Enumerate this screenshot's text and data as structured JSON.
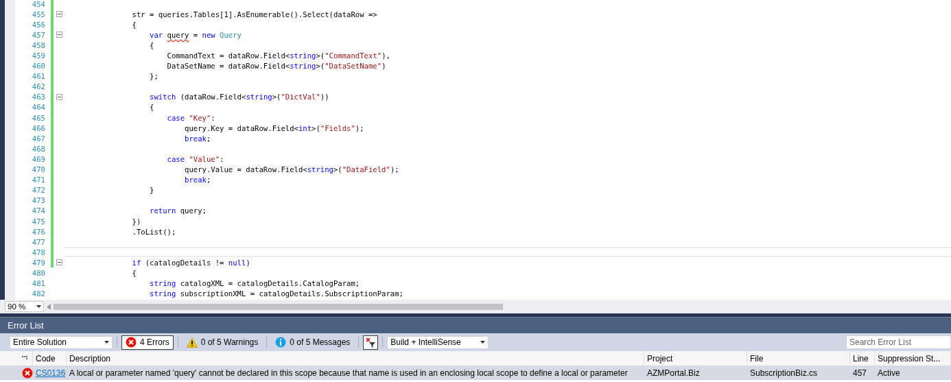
{
  "editor": {
    "lines": [
      {
        "number": "454",
        "changed": true,
        "fold": false,
        "current": false
      },
      {
        "number": "455",
        "changed": true,
        "fold": true,
        "current": false,
        "tokens": [
          {
            "kind": "plain",
            "text": "            str = queries.Tables[1].AsEnumerable().Select(dataRow =>"
          }
        ]
      },
      {
        "number": "456",
        "changed": true,
        "fold": false,
        "current": false,
        "tokens": [
          {
            "kind": "plain",
            "text": "            {"
          }
        ]
      },
      {
        "number": "457",
        "changed": true,
        "fold": true,
        "current": false,
        "tokens": [
          {
            "kind": "keyword",
            "text": "                var "
          },
          {
            "kind": "error",
            "text": "query"
          },
          {
            "kind": "plain",
            "text": " = "
          },
          {
            "kind": "keyword",
            "text": "new "
          },
          {
            "kind": "type",
            "text": "Query"
          }
        ]
      },
      {
        "number": "458",
        "changed": true,
        "fold": false,
        "current": false,
        "tokens": [
          {
            "kind": "plain",
            "text": "                {"
          }
        ]
      },
      {
        "number": "459",
        "changed": true,
        "fold": false,
        "current": false,
        "tokens": [
          {
            "kind": "plain",
            "text": "                    CommandText = dataRow.Field<"
          },
          {
            "kind": "keyword",
            "text": "string"
          },
          {
            "kind": "plain",
            "text": ">("
          },
          {
            "kind": "string",
            "text": "\"CommandText\""
          },
          {
            "kind": "plain",
            "text": "),"
          }
        ]
      },
      {
        "number": "460",
        "changed": true,
        "fold": false,
        "current": false,
        "tokens": [
          {
            "kind": "plain",
            "text": "                    DataSetName = dataRow.Field<"
          },
          {
            "kind": "keyword",
            "text": "string"
          },
          {
            "kind": "plain",
            "text": ">("
          },
          {
            "kind": "string",
            "text": "\"DataSetName\""
          },
          {
            "kind": "plain",
            "text": ")"
          }
        ]
      },
      {
        "number": "461",
        "changed": true,
        "fold": false,
        "current": false,
        "tokens": [
          {
            "kind": "plain",
            "text": "                };"
          }
        ]
      },
      {
        "number": "462",
        "changed": true,
        "fold": false,
        "current": false
      },
      {
        "number": "463",
        "changed": true,
        "fold": true,
        "current": false,
        "tokens": [
          {
            "kind": "keyword",
            "text": "                switch"
          },
          {
            "kind": "plain",
            "text": " (dataRow.Field<"
          },
          {
            "kind": "keyword",
            "text": "string"
          },
          {
            "kind": "plain",
            "text": ">("
          },
          {
            "kind": "string",
            "text": "\"DictVal\""
          },
          {
            "kind": "plain",
            "text": "))"
          }
        ]
      },
      {
        "number": "464",
        "changed": true,
        "fold": false,
        "current": false,
        "tokens": [
          {
            "kind": "plain",
            "text": "                {"
          }
        ]
      },
      {
        "number": "465",
        "changed": true,
        "fold": false,
        "current": false,
        "tokens": [
          {
            "kind": "keyword",
            "text": "                    case "
          },
          {
            "kind": "string",
            "text": "\"Key\""
          },
          {
            "kind": "plain",
            "text": ":"
          }
        ]
      },
      {
        "number": "466",
        "changed": true,
        "fold": false,
        "current": false,
        "tokens": [
          {
            "kind": "plain",
            "text": "                        query.Key = dataRow.Field<"
          },
          {
            "kind": "keyword",
            "text": "int"
          },
          {
            "kind": "plain",
            "text": ">("
          },
          {
            "kind": "string",
            "text": "\"Fields\""
          },
          {
            "kind": "plain",
            "text": ");"
          }
        ]
      },
      {
        "number": "467",
        "changed": true,
        "fold": false,
        "current": false,
        "tokens": [
          {
            "kind": "keyword",
            "text": "                        break"
          },
          {
            "kind": "plain",
            "text": ";"
          }
        ]
      },
      {
        "number": "468",
        "changed": true,
        "fold": false,
        "current": false
      },
      {
        "number": "469",
        "changed": true,
        "fold": false,
        "current": false,
        "tokens": [
          {
            "kind": "keyword",
            "text": "                    case "
          },
          {
            "kind": "string",
            "text": "\"Value\""
          },
          {
            "kind": "plain",
            "text": ":"
          }
        ]
      },
      {
        "number": "470",
        "changed": true,
        "fold": false,
        "current": false,
        "tokens": [
          {
            "kind": "plain",
            "text": "                        query.Value = dataRow.Field<"
          },
          {
            "kind": "keyword",
            "text": "string"
          },
          {
            "kind": "plain",
            "text": ">("
          },
          {
            "kind": "string",
            "text": "\"DataField\""
          },
          {
            "kind": "plain",
            "text": ");"
          }
        ]
      },
      {
        "number": "471",
        "changed": true,
        "fold": false,
        "current": false,
        "tokens": [
          {
            "kind": "keyword",
            "text": "                        break"
          },
          {
            "kind": "plain",
            "text": ";"
          }
        ]
      },
      {
        "number": "472",
        "changed": true,
        "fold": false,
        "current": false,
        "tokens": [
          {
            "kind": "plain",
            "text": "                }"
          }
        ]
      },
      {
        "number": "473",
        "changed": true,
        "fold": false,
        "current": false
      },
      {
        "number": "474",
        "changed": true,
        "fold": false,
        "current": false,
        "tokens": [
          {
            "kind": "keyword",
            "text": "                return"
          },
          {
            "kind": "plain",
            "text": " query;"
          }
        ]
      },
      {
        "number": "475",
        "changed": true,
        "fold": false,
        "current": false,
        "tokens": [
          {
            "kind": "plain",
            "text": "            })"
          }
        ]
      },
      {
        "number": "476",
        "changed": true,
        "fold": false,
        "current": false,
        "tokens": [
          {
            "kind": "plain",
            "text": "            .ToList();"
          }
        ]
      },
      {
        "number": "477",
        "changed": true,
        "fold": false,
        "current": false
      },
      {
        "number": "478",
        "changed": true,
        "fold": false,
        "current": true
      },
      {
        "number": "479",
        "changed": true,
        "fold": true,
        "current": false,
        "tokens": [
          {
            "kind": "keyword",
            "text": "            if"
          },
          {
            "kind": "plain",
            "text": " (catalogDetails != "
          },
          {
            "kind": "keyword",
            "text": "null"
          },
          {
            "kind": "plain",
            "text": ")"
          }
        ]
      },
      {
        "number": "480",
        "changed": false,
        "fold": false,
        "current": false,
        "tokens": [
          {
            "kind": "plain",
            "text": "            {"
          }
        ]
      },
      {
        "number": "481",
        "changed": false,
        "fold": false,
        "current": false,
        "tokens": [
          {
            "kind": "keyword",
            "text": "                string"
          },
          {
            "kind": "plain",
            "text": " catalogXML = catalogDetails.CatalogParam;"
          }
        ]
      },
      {
        "number": "482",
        "changed": false,
        "fold": false,
        "current": false,
        "tokens": [
          {
            "kind": "keyword",
            "text": "                string"
          },
          {
            "kind": "plain",
            "text": " subscriptionXML = catalogDetails.SubscriptionParam;"
          }
        ]
      }
    ],
    "zoom": "90 %"
  },
  "error_list": {
    "title": "Error List",
    "scope": "Entire Solution",
    "filters": [
      {
        "kind": "error",
        "label": "4 Errors",
        "selected": true
      },
      {
        "kind": "warning",
        "label": "0 of 5 Warnings",
        "selected": false
      },
      {
        "kind": "info",
        "label": "0 of 5 Messages",
        "selected": false
      }
    ],
    "source": "Build + IntelliSense",
    "search": {
      "placeholder": "Search Error List"
    },
    "columns": [
      "Code",
      "Description",
      "Project",
      "File",
      "Line",
      "Suppression St..."
    ],
    "rows": [
      {
        "code": "CS0136",
        "description": "A local or parameter named 'query' cannot be declared in this scope because that name is used in an enclosing local scope to define a local or parameter",
        "project": "AZMPortal.Biz",
        "file": "SubscriptionBiz.cs",
        "line": "457",
        "suppression": "Active",
        "selected": true
      }
    ]
  }
}
